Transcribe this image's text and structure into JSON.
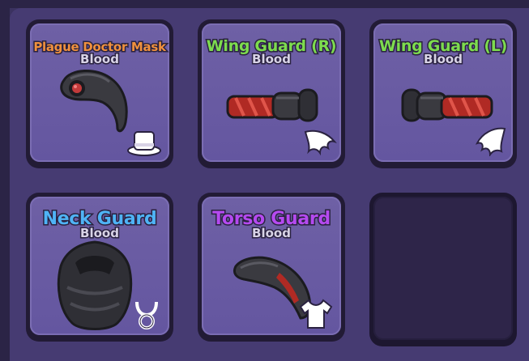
{
  "inventory": {
    "slots": [
      {
        "name": "Plague Doctor Mask",
        "variant": "Blood",
        "name_color": "#f0913e",
        "type_icon": "top-hat-icon"
      },
      {
        "name": "Wing Guard (R)",
        "variant": "Blood",
        "name_color": "#7ddc4e",
        "type_icon": "right-wing-icon"
      },
      {
        "name": "Wing Guard (L)",
        "variant": "Blood",
        "name_color": "#7ddc4e",
        "type_icon": "left-wing-icon"
      },
      {
        "name": "Neck Guard",
        "variant": "Blood",
        "name_color": "#4fb3f5",
        "type_icon": "necklace-icon"
      },
      {
        "name": "Torso Guard",
        "variant": "Blood",
        "name_color": "#b54af0",
        "type_icon": "shirt-icon"
      },
      {
        "name": "",
        "variant": "",
        "type_icon": ""
      }
    ]
  }
}
